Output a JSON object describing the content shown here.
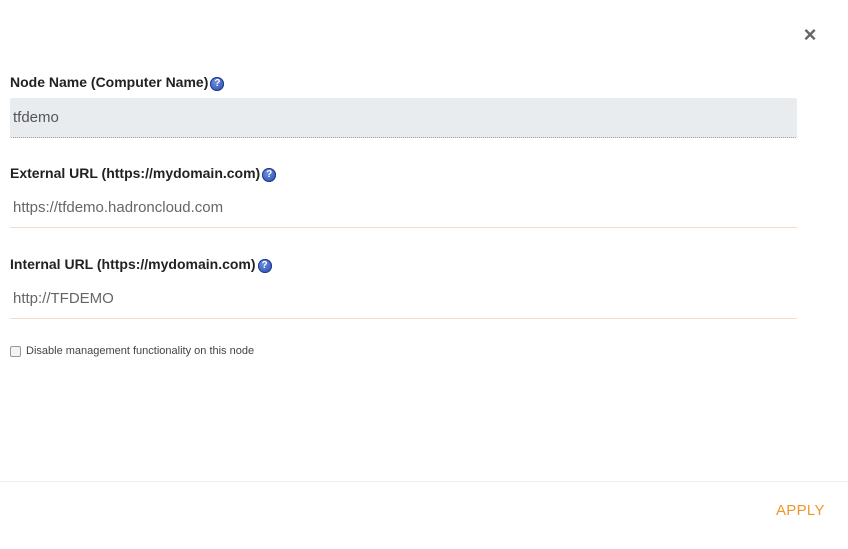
{
  "dialog": {
    "close_glyph": "×"
  },
  "fields": {
    "node_name": {
      "label": "Node Name (Computer Name)",
      "value": "tfdemo",
      "help_glyph": "?"
    },
    "external_url": {
      "label": "External URL (https://mydomain.com)",
      "value": "https://tfdemo.hadroncloud.com",
      "help_glyph": "?"
    },
    "internal_url": {
      "label": "Internal URL (https://mydomain.com)",
      "value": "http://TFDEMO",
      "help_glyph": "?"
    }
  },
  "checkbox": {
    "label": "Disable management functionality on this node",
    "checked": false
  },
  "footer": {
    "apply_label": "APPLY"
  },
  "colors": {
    "accent": "#f0962c",
    "help_icon": "#2346a8",
    "readonly_bg": "#e9ecef"
  }
}
